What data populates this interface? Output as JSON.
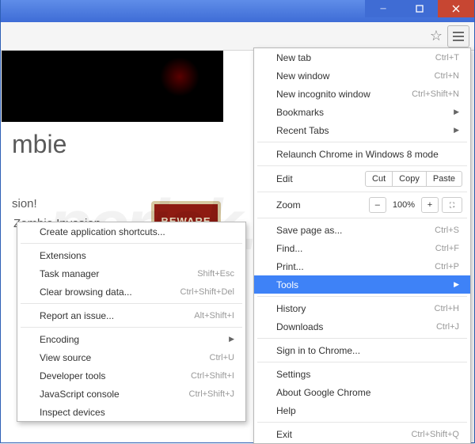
{
  "titlebar": {
    "min": "–",
    "max": "▢",
    "close": "✕"
  },
  "page": {
    "heading": "mbie",
    "line1": "sion!",
    "line2": "Zombie Invasion",
    "beware": "BEWARE"
  },
  "watermark": "pcrisk.com",
  "mainmenu": {
    "new_tab": "New tab",
    "new_tab_sc": "Ctrl+T",
    "new_window": "New window",
    "new_window_sc": "Ctrl+N",
    "incognito": "New incognito window",
    "incognito_sc": "Ctrl+Shift+N",
    "bookmarks": "Bookmarks",
    "recent": "Recent Tabs",
    "relaunch": "Relaunch Chrome in Windows 8 mode",
    "edit": "Edit",
    "cut": "Cut",
    "copy": "Copy",
    "paste": "Paste",
    "zoom": "Zoom",
    "zoom_pct": "100%",
    "save": "Save page as...",
    "save_sc": "Ctrl+S",
    "find": "Find...",
    "find_sc": "Ctrl+F",
    "print": "Print...",
    "print_sc": "Ctrl+P",
    "tools": "Tools",
    "history": "History",
    "history_sc": "Ctrl+H",
    "downloads": "Downloads",
    "downloads_sc": "Ctrl+J",
    "signin": "Sign in to Chrome...",
    "settings": "Settings",
    "about": "About Google Chrome",
    "help": "Help",
    "exit": "Exit",
    "exit_sc": "Ctrl+Shift+Q"
  },
  "submenu": {
    "create_shortcuts": "Create application shortcuts...",
    "extensions": "Extensions",
    "task_manager": "Task manager",
    "task_manager_sc": "Shift+Esc",
    "clear_data": "Clear browsing data...",
    "clear_data_sc": "Ctrl+Shift+Del",
    "report": "Report an issue...",
    "report_sc": "Alt+Shift+I",
    "encoding": "Encoding",
    "view_source": "View source",
    "view_source_sc": "Ctrl+U",
    "dev_tools": "Developer tools",
    "dev_tools_sc": "Ctrl+Shift+I",
    "js_console": "JavaScript console",
    "js_console_sc": "Ctrl+Shift+J",
    "inspect": "Inspect devices"
  }
}
